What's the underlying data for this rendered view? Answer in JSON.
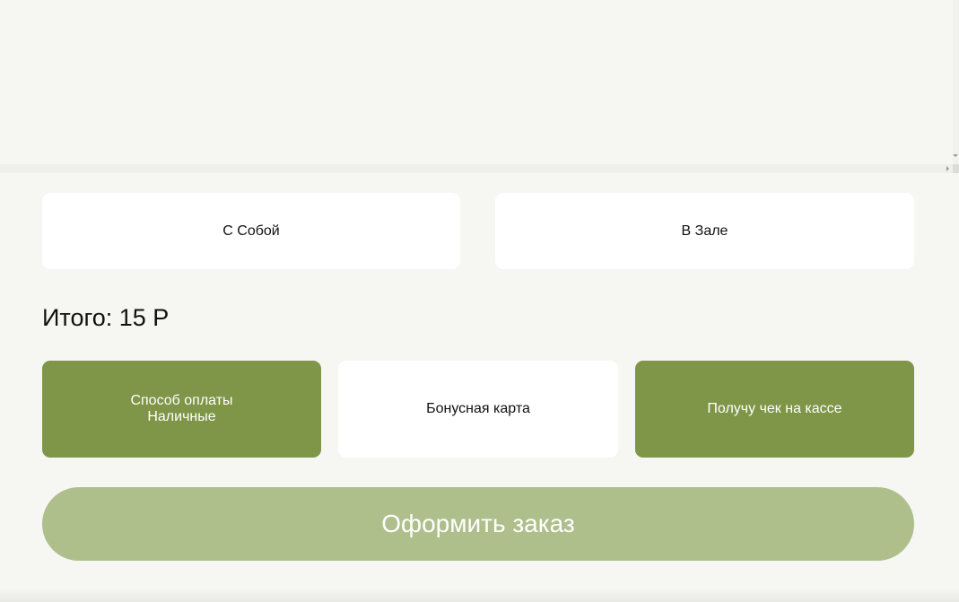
{
  "order_type": {
    "takeaway_label": "С Собой",
    "dine_in_label": "В Зале"
  },
  "total": {
    "text": "Итого: 15 Р"
  },
  "options": {
    "payment_title": "Способ оплаты",
    "payment_value": "Наличные",
    "bonus_label": "Бонусная карта",
    "receipt_label": "Получу чек на кассе"
  },
  "checkout": {
    "label": "Оформить заказ"
  },
  "colors": {
    "accent_green": "#7f9547",
    "checkout_disabled_green": "#aebf8c",
    "page_background": "#f6f7f3"
  }
}
